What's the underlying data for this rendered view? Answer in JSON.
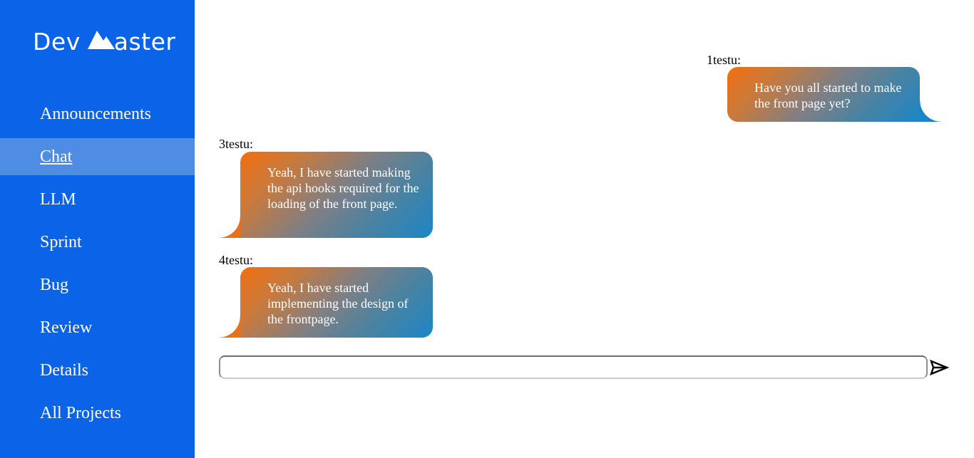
{
  "brand": {
    "name_left": "Dev",
    "name_right": "aster",
    "logo_icon": "mountain-icon"
  },
  "sidebar": {
    "items": [
      {
        "label": "Announcements",
        "active": false
      },
      {
        "label": "Chat",
        "active": true
      },
      {
        "label": "LLM",
        "active": false
      },
      {
        "label": "Sprint",
        "active": false
      },
      {
        "label": "Bug",
        "active": false
      },
      {
        "label": "Review",
        "active": false
      },
      {
        "label": "Details",
        "active": false
      },
      {
        "label": "All Projects",
        "active": false
      }
    ]
  },
  "chat": {
    "messages": [
      {
        "sender": "1testu:",
        "text": "Have you all started to make the front page yet?",
        "side": "right"
      },
      {
        "sender": "3testu:",
        "text": "Yeah, I have started making the api hooks required for the loading of the front page.",
        "side": "left"
      },
      {
        "sender": "4testu:",
        "text": "Yeah, I have started implementing the design of the frontpage.",
        "side": "left"
      }
    ],
    "input": {
      "value": "",
      "placeholder": ""
    },
    "send_icon": "send-icon"
  },
  "colors": {
    "sidebar_bg": "#0b64e8",
    "sidebar_active_bg": "#4f8de5",
    "bubble_gradient_start": "#f36f10",
    "bubble_gradient_end": "#1a86c8"
  }
}
